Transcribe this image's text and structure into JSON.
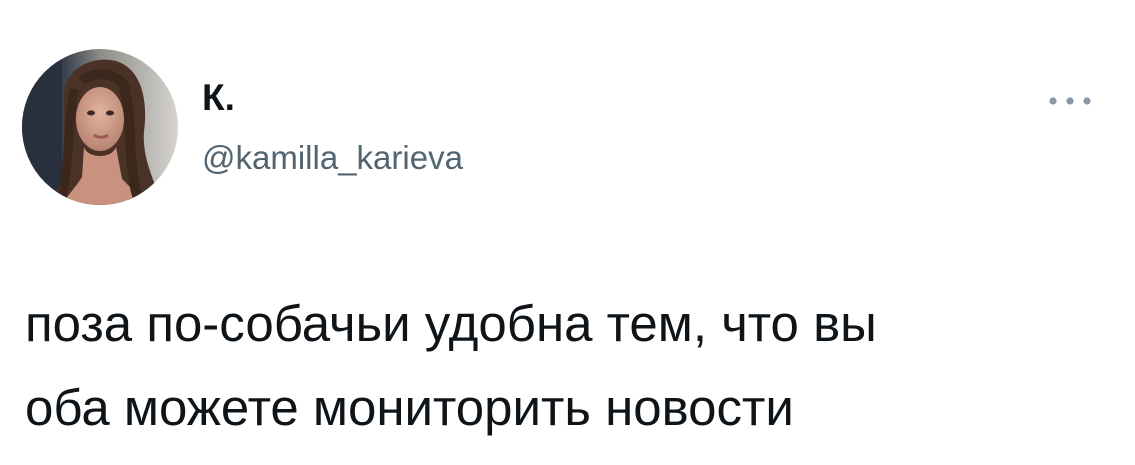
{
  "tweet": {
    "author": {
      "display_name": "К.",
      "handle": "@kamilla_karieva",
      "avatar_icon": "profile-photo"
    },
    "more_icon": "more-horizontal-icon",
    "text": "поза по-собачьи удобна тем, что вы\nоба можете мониторить новости"
  },
  "colors": {
    "text_primary": "#0f1419",
    "text_secondary": "#536471",
    "background": "#ffffff"
  }
}
